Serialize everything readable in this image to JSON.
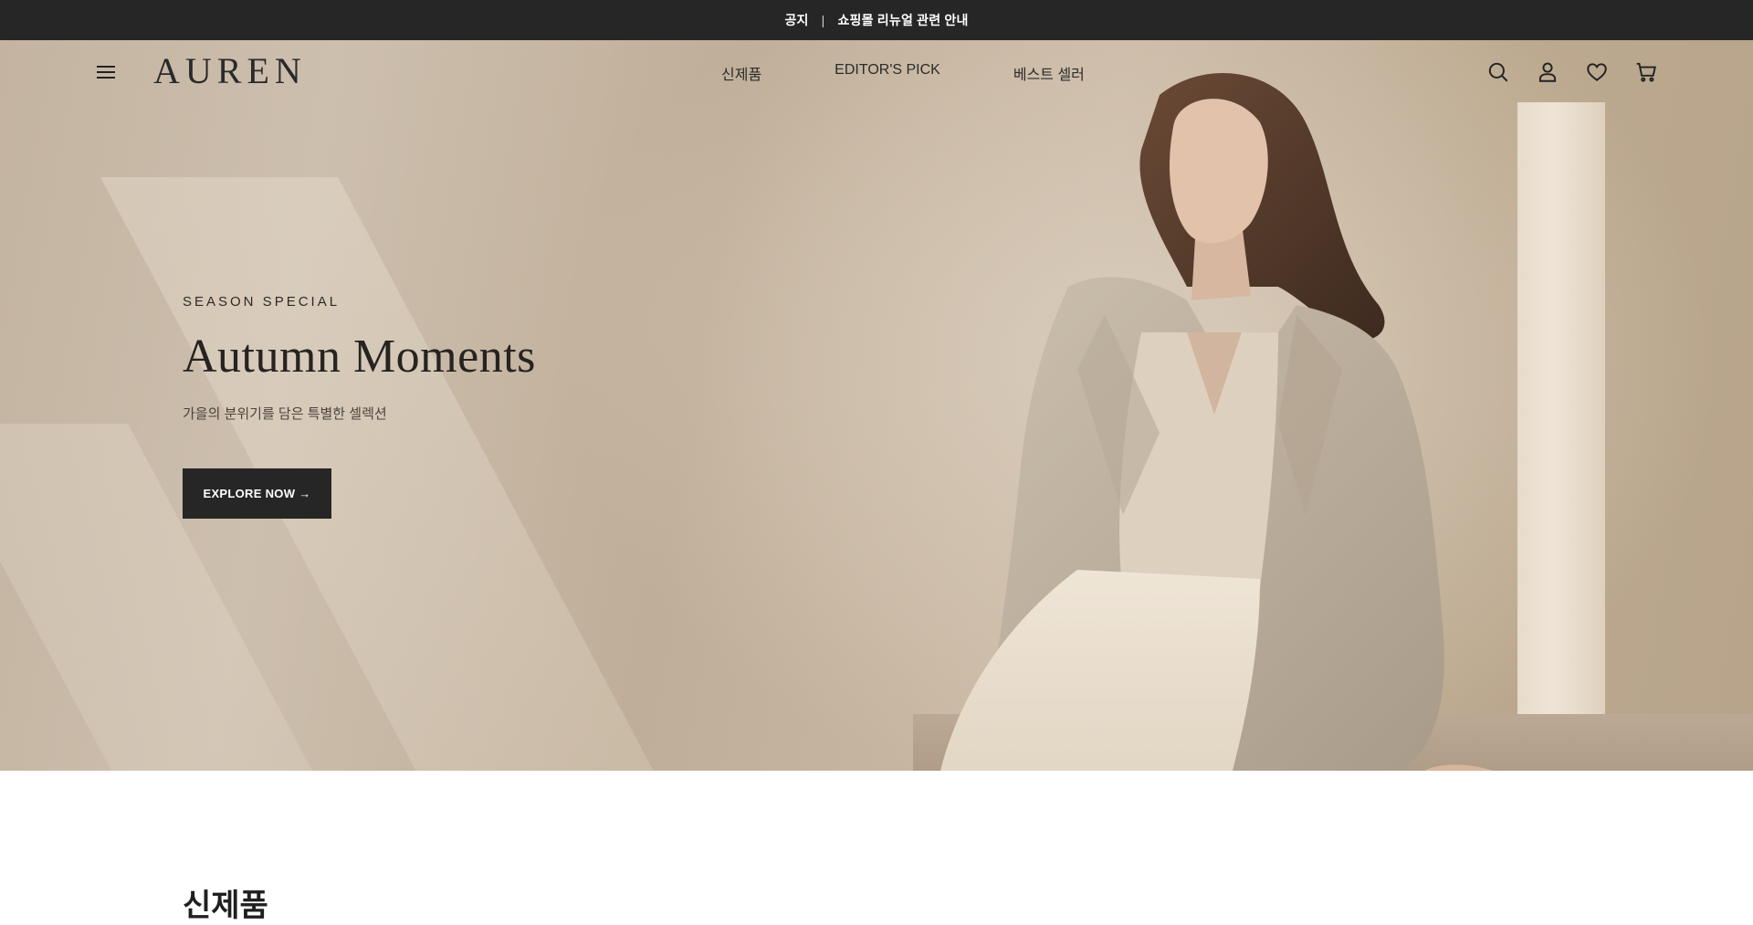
{
  "notice_bar": {
    "label": "공지",
    "separator": "|",
    "message": "쇼핑몰 리뉴얼 관련 안내"
  },
  "header": {
    "logo": "AUREN",
    "nav": [
      {
        "label": "신제품"
      },
      {
        "label": "EDITOR'S PICK"
      },
      {
        "label": "베스트 셀러"
      }
    ],
    "icons": [
      "search-icon",
      "user-icon",
      "heart-icon",
      "cart-icon"
    ]
  },
  "hero": {
    "eyebrow": "SEASON SPECIAL",
    "title": "Autumn Moments",
    "subtitle": "가을의 분위기를 담은 특별한 셀렉션",
    "cta_label": "EXPLORE NOW →"
  },
  "sections": {
    "new_arrivals_title": "신제품"
  },
  "colors": {
    "notice_bg": "#262626",
    "cta_bg": "#262626",
    "hero_tone": "#c6b6a2"
  }
}
